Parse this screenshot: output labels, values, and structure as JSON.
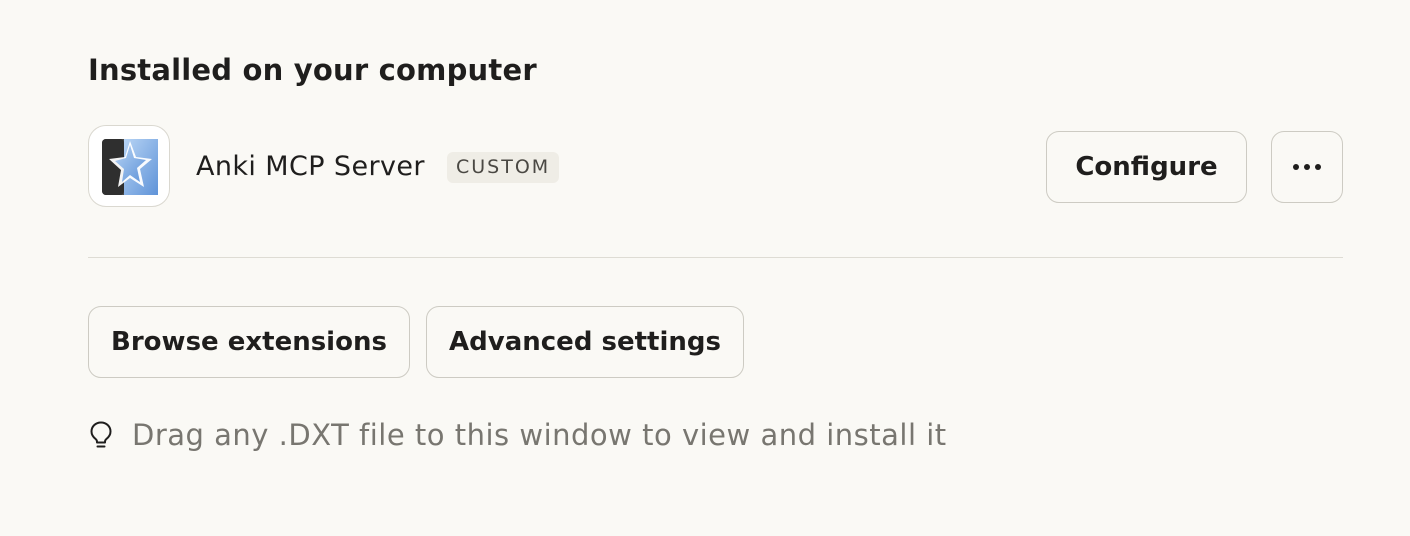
{
  "section": {
    "title": "Installed on your computer"
  },
  "extension": {
    "name": "Anki MCP Server",
    "badge": "CUSTOM",
    "icon": "anki-star-icon",
    "configure_label": "Configure",
    "more_icon": "ellipsis-icon"
  },
  "actions": {
    "browse_label": "Browse extensions",
    "advanced_label": "Advanced settings"
  },
  "hint": {
    "icon": "lightbulb-icon",
    "text": "Drag any .DXT file to this window to view and install it"
  },
  "colors": {
    "background": "#faf9f5",
    "button_border": "#cdcbc3",
    "hint_text": "#787670",
    "icon_blue": "#7fb0ea"
  }
}
